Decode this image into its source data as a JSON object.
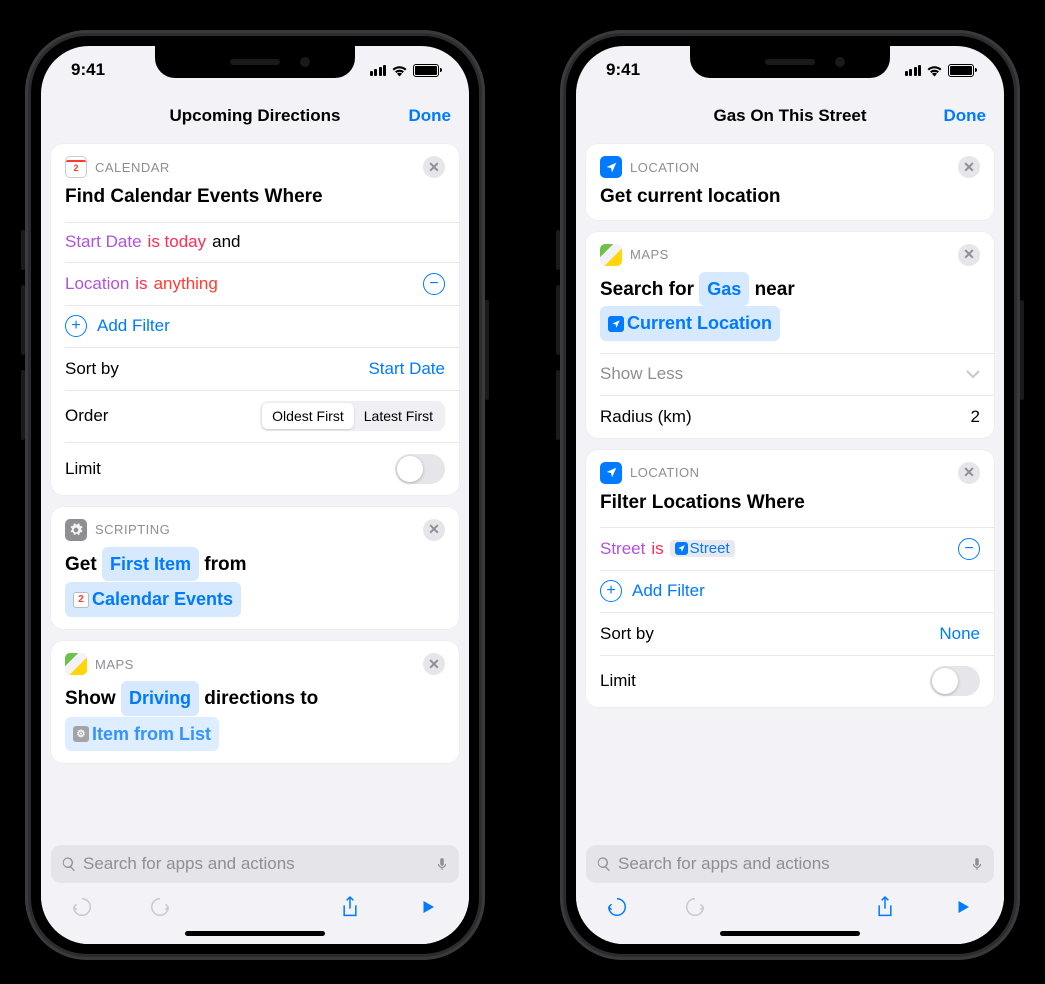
{
  "status": {
    "time": "9:41"
  },
  "phones": [
    {
      "key": "left",
      "title": "Upcoming Directions",
      "done": "Done",
      "search_placeholder": "Search for apps and actions",
      "cards": {
        "calendar": {
          "app": "CALENDAR",
          "title": "Find Calendar Events Where",
          "f1_field": "Start Date",
          "f1_op": "is today",
          "f1_join": "and",
          "f2_field": "Location",
          "f2_op": "is",
          "f2_val": "anything",
          "add": "Add Filter",
          "sort_label": "Sort by",
          "sort_value": "Start Date",
          "order_label": "Order",
          "seg_old": "Oldest First",
          "seg_new": "Latest First",
          "limit": "Limit"
        },
        "scripting": {
          "app": "SCRIPTING",
          "w1": "Get",
          "tok1": "First Item",
          "w2": "from",
          "tok2": "Calendar Events"
        },
        "maps": {
          "app": "MAPS",
          "w1": "Show",
          "tok1": "Driving",
          "w2": "directions to",
          "tok2": "Item from List"
        }
      }
    },
    {
      "key": "right",
      "title": "Gas On This Street",
      "done": "Done",
      "search_placeholder": "Search for apps and actions",
      "cards": {
        "loc1": {
          "app": "LOCATION",
          "title": "Get current location"
        },
        "maps": {
          "app": "MAPS",
          "w1": "Search for",
          "tok1": "Gas",
          "w2": "near",
          "tok2": "Current Location",
          "showless": "Show Less",
          "radius_label": "Radius (km)",
          "radius_value": "2"
        },
        "filter": {
          "app": "LOCATION",
          "title": "Filter Locations Where",
          "f_field": "Street",
          "f_op": "is",
          "f_token": "Street",
          "add": "Add Filter",
          "sort_label": "Sort by",
          "sort_value": "None",
          "limit": "Limit"
        }
      }
    }
  ]
}
